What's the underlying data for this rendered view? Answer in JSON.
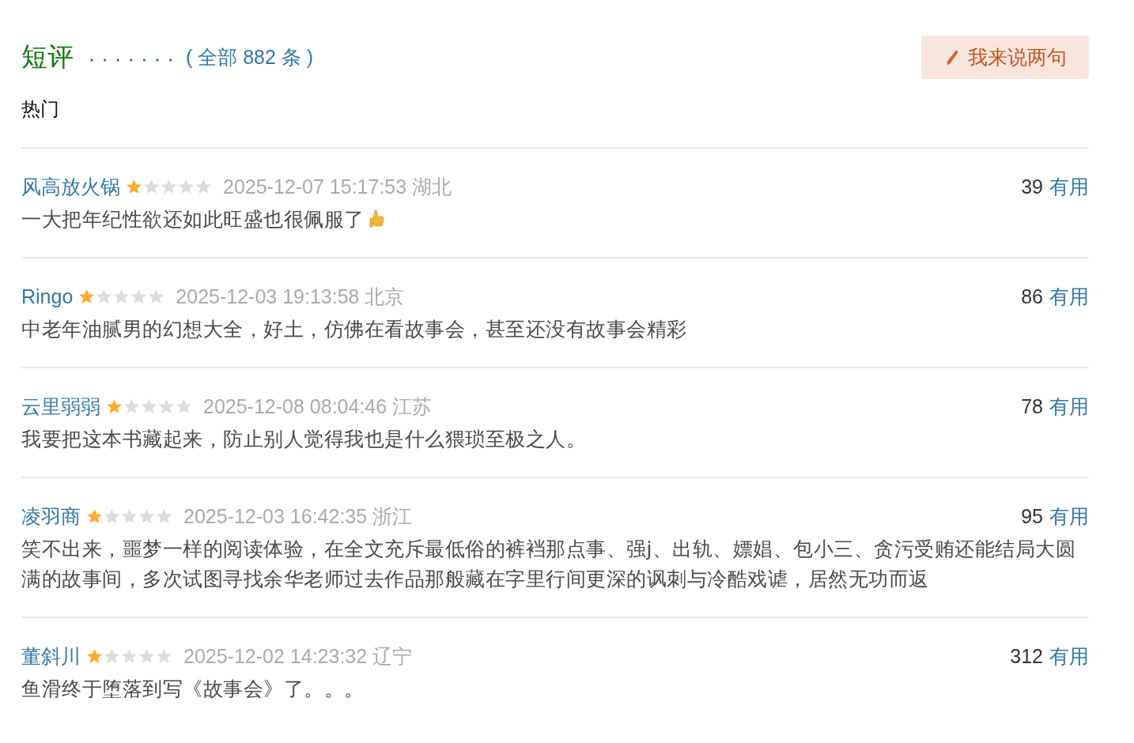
{
  "header": {
    "title": "短评",
    "count_link": "( 全部 882 条 )",
    "write_button": "我来说两句"
  },
  "filter": {
    "label": "热门"
  },
  "comments": [
    {
      "user": "风高放火锅",
      "stars": 1,
      "time": "2025-12-07 15:17:53",
      "location": "湖北",
      "votes": "39",
      "useful": "有用",
      "text": "一大把年纪性欲还如此旺盛也很佩服了",
      "thumbs_up": true
    },
    {
      "user": "Ringo",
      "stars": 1,
      "time": "2025-12-03 19:13:58",
      "location": "北京",
      "votes": "86",
      "useful": "有用",
      "text": "中老年油腻男的幻想大全，好土，仿佛在看故事会，甚至还没有故事会精彩"
    },
    {
      "user": "云里弱弱",
      "stars": 1,
      "time": "2025-12-08 08:04:46",
      "location": "江苏",
      "votes": "78",
      "useful": "有用",
      "text": "我要把这本书藏起来，防止别人觉得我也是什么猥琐至极之人。"
    },
    {
      "user": "凌羽商",
      "stars": 1,
      "time": "2025-12-03 16:42:35",
      "location": "浙江",
      "votes": "95",
      "useful": "有用",
      "text": "笑不出来，噩梦一样的阅读体验，在全文充斥最低俗的裤裆那点事、强j、出轨、嫖娼、包小三、贪污受贿还能结局大圆满的故事间，多次试图寻找余华老师过去作品那般藏在字里行间更深的讽刺与冷酷戏谑，居然无功而返"
    },
    {
      "user": "董斜川",
      "stars": 1,
      "time": "2025-12-02 14:23:32",
      "location": "辽宁",
      "votes": "312",
      "useful": "有用",
      "text": "鱼滑终于堕落到写《故事会》了。。。"
    }
  ]
}
